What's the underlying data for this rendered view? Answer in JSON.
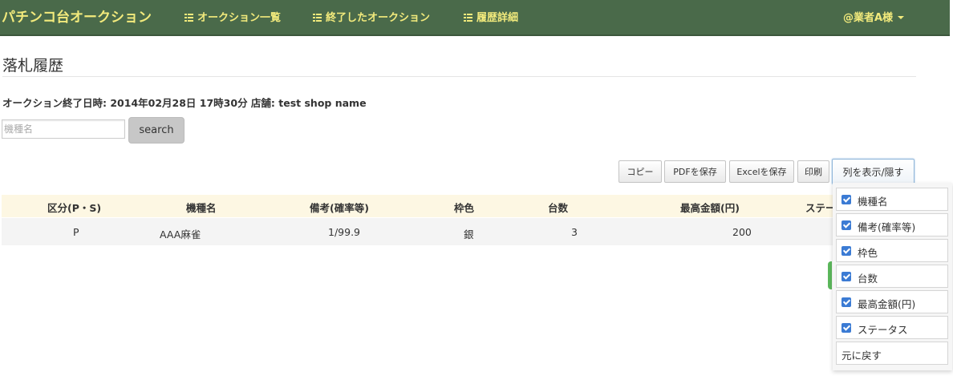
{
  "navbar": {
    "brand": "パチンコ台オークション",
    "links": [
      {
        "label": "オークション一覧",
        "icon": "list-icon"
      },
      {
        "label": "終了したオークション",
        "icon": "list-icon"
      },
      {
        "label": "履歴詳細",
        "icon": "list-icon"
      }
    ],
    "user_menu": "@業者A様",
    "accent_color": "#f2ea7c",
    "bar_color": "#4a6a4a"
  },
  "page": {
    "title": "落札履歴",
    "info": "オークション終了日時: 2014年02月28日 17時30分 店舗: test shop name"
  },
  "search": {
    "placeholder": "機種名",
    "value": "",
    "button_label": "search"
  },
  "toolbar": {
    "copy": "コピー",
    "pdf": "PDFを保存",
    "excel": "Excelを保存",
    "print": "印刷",
    "columns": "列を表示/隠す"
  },
  "table": {
    "headers": [
      "区分(P・S)",
      "機種名",
      "備考(確率等)",
      "枠色",
      "台数",
      "最高金額(円)",
      "ステー"
    ],
    "rows": [
      [
        "P",
        "AAA麻雀",
        "1/99.9",
        "銀",
        "3",
        "200"
      ]
    ]
  },
  "column_menu": {
    "items": [
      {
        "label": "機種名",
        "checked": true
      },
      {
        "label": "備考(確率等)",
        "checked": true
      },
      {
        "label": "枠色",
        "checked": true
      },
      {
        "label": "台数",
        "checked": true
      },
      {
        "label": "最高金額(円)",
        "checked": true
      },
      {
        "label": "ステータス",
        "checked": true
      }
    ],
    "restore": "元に戻す"
  }
}
